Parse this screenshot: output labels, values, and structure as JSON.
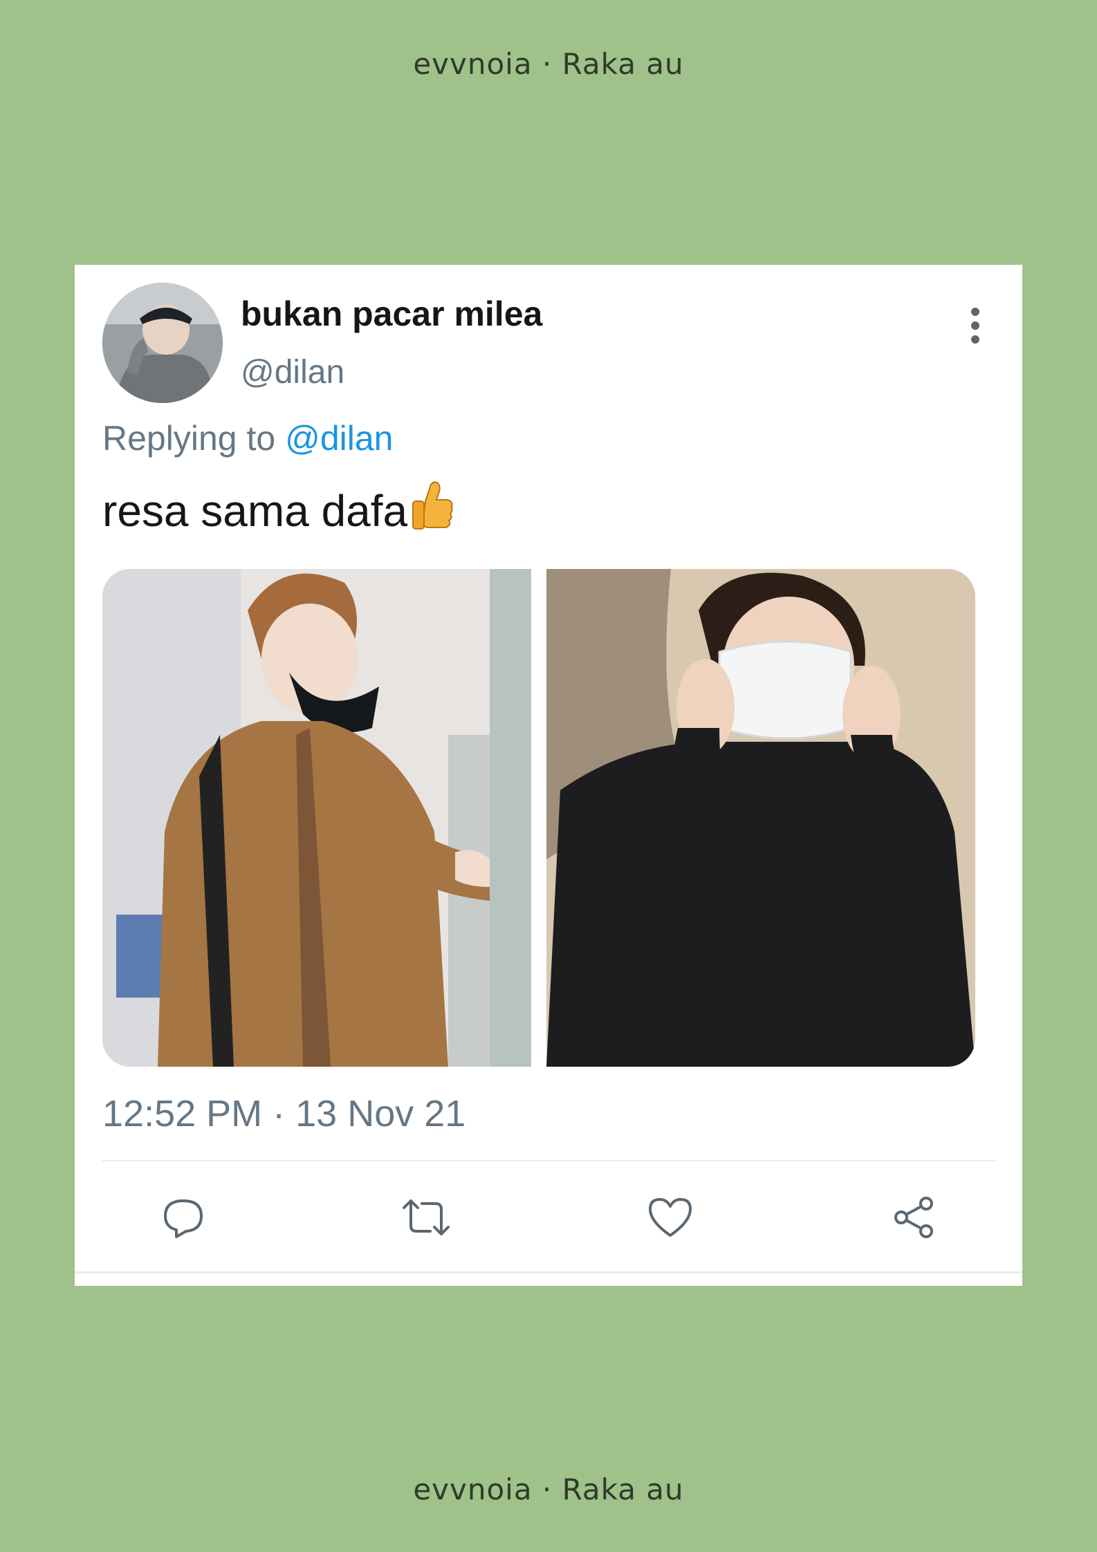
{
  "watermark": {
    "top": "evvnoia · Raka au",
    "bottom": "evvnoia · Raka au"
  },
  "tweet": {
    "display_name": "bukan pacar milea",
    "handle": "@dilan",
    "reply_prefix": "Replying to",
    "reply_to": "@dilan",
    "text": "resa sama dafa",
    "emoji": "thumbs-up",
    "timestamp": "12:52 PM · 13 Nov 21",
    "media_count": 2
  },
  "actions": [
    {
      "icon": "reply-icon"
    },
    {
      "icon": "retweet-icon"
    },
    {
      "icon": "like-icon"
    },
    {
      "icon": "share-icon"
    }
  ],
  "colors": {
    "background": "#9fc18a",
    "card": "#ffffff",
    "muted": "#657786",
    "link": "#1b95e0",
    "text": "#14171a"
  }
}
